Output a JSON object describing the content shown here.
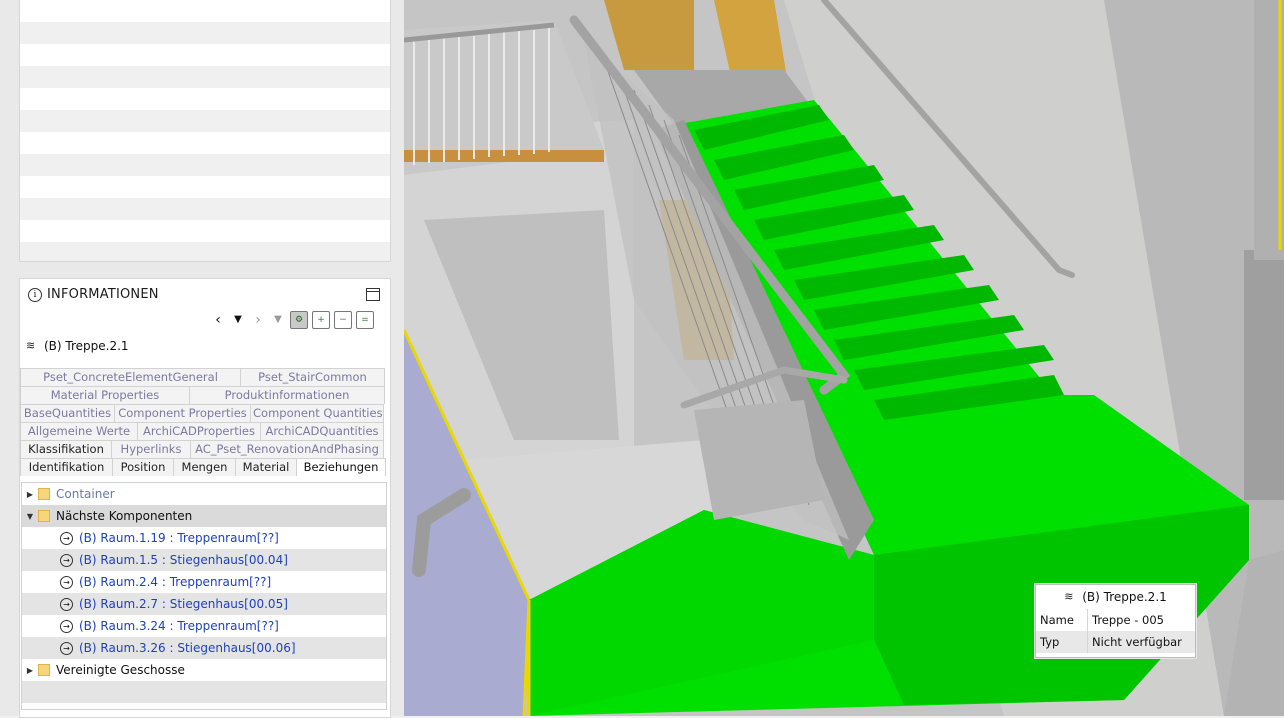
{
  "panel": {
    "title": "INFORMATIONEN",
    "object_name": "(B) Treppe.2.1"
  },
  "nav": {
    "back": "‹",
    "dropdown": "▼",
    "forward": "›",
    "dropdown2": "▼"
  },
  "tabs": {
    "row1": [
      "Pset_ConcreteElementGeneral",
      "Pset_StairCommon"
    ],
    "row2": [
      "Material Properties",
      "Produktinformationen"
    ],
    "row3": [
      "BaseQuantities",
      "Component Properties",
      "Component Quantities"
    ],
    "row4": [
      "Allgemeine Werte",
      "ArchiCADProperties",
      "ArchiCADQuantities"
    ],
    "row5": [
      "Klassifikation",
      "Hyperlinks",
      "AC_Pset_RenovationAndPhasing"
    ],
    "row6": [
      "Identifikation",
      "Position",
      "Mengen",
      "Material",
      "Beziehungen"
    ]
  },
  "tree": {
    "container": "Container",
    "naechste": "Nächste Komponenten",
    "items": [
      "(B) Raum.1.19 : Treppenraum[??]",
      "(B) Raum.1.5 : Stiegenhaus[00.04]",
      "(B) Raum.2.4 : Treppenraum[??]",
      "(B) Raum.2.7 : Stiegenhaus[00.05]",
      "(B) Raum.3.24 : Treppenraum[??]",
      "(B) Raum.3.26 : Stiegenhaus[00.06]"
    ],
    "vereinigte": "Vereinigte Geschosse"
  },
  "tooltip": {
    "title": "(B) Treppe.2.1",
    "rows": [
      {
        "key": "Name",
        "value": "Treppe - 005"
      },
      {
        "key": "Typ",
        "value": "Nicht verfügbar"
      }
    ]
  },
  "colors": {
    "stair_green": "#00e000",
    "wall_gray": "#c7c7c7",
    "wood": "#c89a40",
    "accent_yellow": "#ffeb3b",
    "link": "#1f3fbf"
  }
}
